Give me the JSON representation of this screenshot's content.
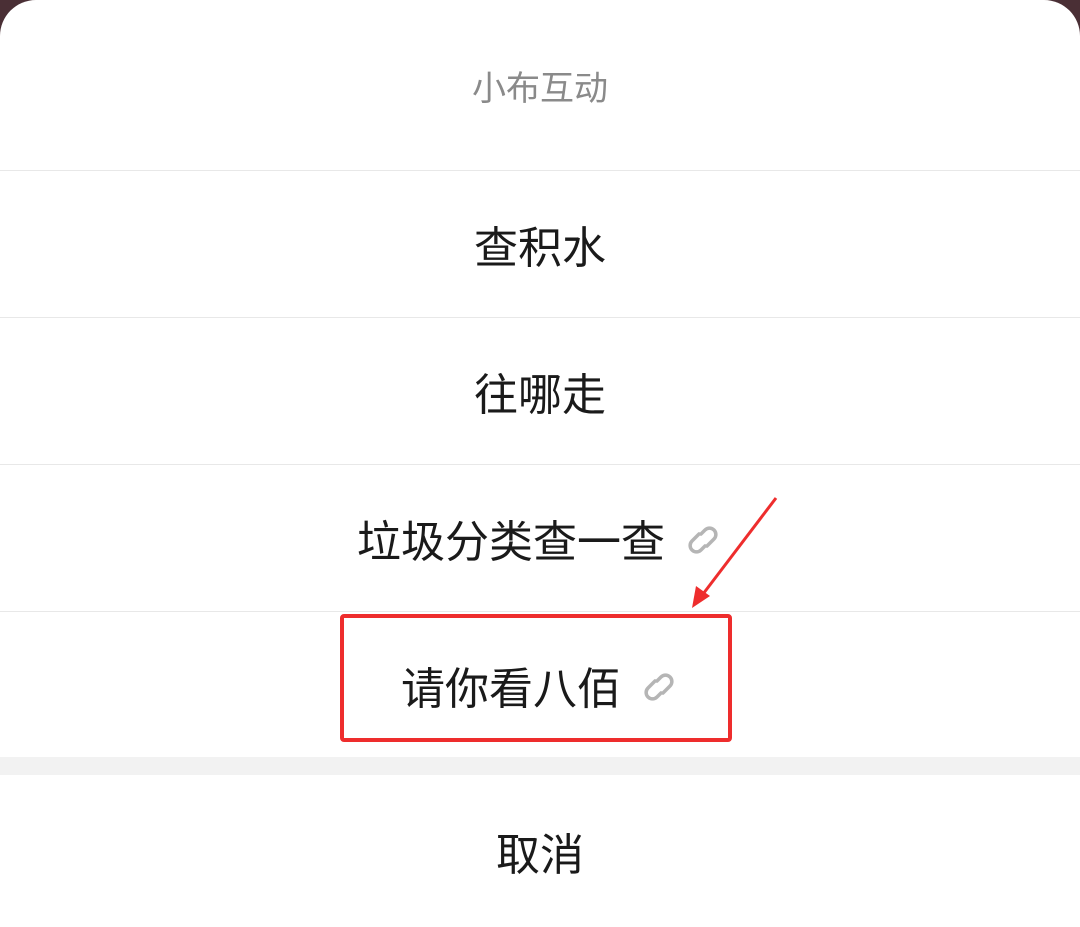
{
  "sheet": {
    "title": "小布互动",
    "options": [
      {
        "label": "查积水",
        "has_link_icon": false
      },
      {
        "label": "往哪走",
        "has_link_icon": false
      },
      {
        "label": "垃圾分类查一查",
        "has_link_icon": true
      },
      {
        "label": "请你看八佰",
        "has_link_icon": true
      }
    ],
    "cancel_label": "取消"
  },
  "annotation": {
    "highlight_color": "#ee2d2d",
    "icon": "link-icon"
  }
}
